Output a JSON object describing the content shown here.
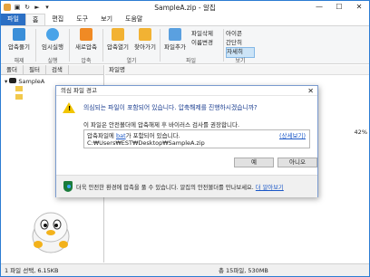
{
  "window": {
    "title": "SampleA.zip - 알집"
  },
  "ribbon_tabs": [
    "파일",
    "홈",
    "편집",
    "도구",
    "보기",
    "도움말"
  ],
  "ribbon": {
    "groups": [
      {
        "icon": "compress-icon",
        "label": "압축풀기"
      },
      {
        "icon": "run-icon",
        "label": "임시실행"
      },
      {
        "icon": "new-archive-icon",
        "label": "새로압축"
      },
      {
        "icon": "open-archive-icon",
        "label": "압축열기"
      },
      {
        "icon": "find-icon",
        "label": "찾아가기"
      },
      {
        "icon": "add-file-icon",
        "label": "파일추가"
      }
    ],
    "mid_list": [
      "파일삭제",
      "이름변경"
    ],
    "view_list": [
      "아이콘",
      "간단히",
      "자세히"
    ],
    "group_labels": [
      "해제",
      "실행",
      "압축",
      "열기",
      "파일",
      "보기"
    ]
  },
  "left_tabs": [
    "폴더",
    "필터",
    "검색"
  ],
  "tree": [
    "SampleA"
  ],
  "right_header": "파일명",
  "dialog": {
    "title": "의심 파일 경고",
    "message": "의심되는 파일이 포함되어 있습니다. 압축해제를 진행하시겠습니까?",
    "recommend": "이 파일은 안전볼더에 압축해제 후 바이러스 검사를 권장합니다.",
    "detail_link": "(상세보기)",
    "box_line1_prefix": "압축파일에 ",
    "box_link": "bat",
    "box_line1_suffix": "가 포함되어 있습니다.",
    "box_line2": "C:₩Users₩EST₩Desktop₩SampleA.zip",
    "yes": "예",
    "no": "아니오",
    "footer": "더욱 안전한 환경에 압축을 풀 수 있습니다. 알집의 안전볼더를 만나보세요.",
    "footer_link": "더 알아보기"
  },
  "status": {
    "left": "1 파일 선택, 6.15KB",
    "right": "총 15파일, 530MB",
    "side_pct": "42"
  }
}
